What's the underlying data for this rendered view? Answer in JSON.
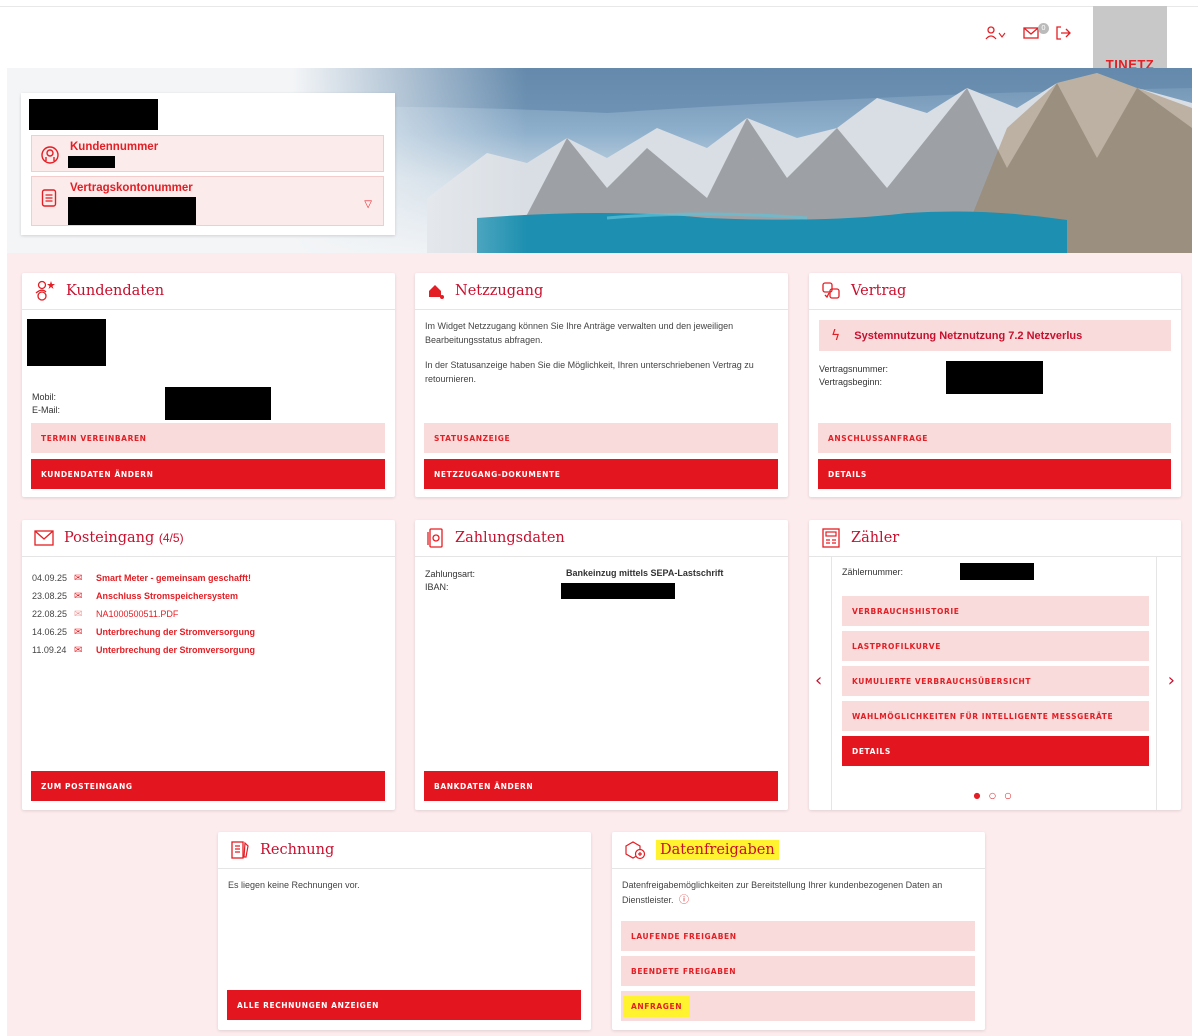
{
  "header": {
    "icons": [
      "user-menu-icon",
      "mail-icon",
      "logout-icon"
    ],
    "mail_count": "0",
    "logo": "TINETZ"
  },
  "account": {
    "customer_number_label": "Kundennummer",
    "contract_account_label": "Vertragskontonummer"
  },
  "kundendaten": {
    "title": "Kundendaten",
    "mobile_label": "Mobil:",
    "email_label": "E-Mail:",
    "btn_termin": "TERMIN VEREINBAREN",
    "btn_change": "KUNDENDATEN ÄNDERN"
  },
  "netzzugang": {
    "title": "Netzzugang",
    "text1": "Im Widget Netzzugang können Sie Ihre Anträge verwalten und den jeweiligen Bearbeitungsstatus abfragen.",
    "text2": "In der Statusanzeige haben Sie die Möglichkeit, Ihren unterschriebenen Vertrag zu retournieren.",
    "btn_status": "STATUSANZEIGE",
    "btn_docs": "NETZZUGANG-DOKUMENTE"
  },
  "vertrag": {
    "title": "Vertrag",
    "product": "Systemnutzung Netznutzung 7.2 Netzverlus",
    "contract_no_label": "Vertragsnummer:",
    "contract_start_label": "Vertragsbeginn:",
    "btn_request": "ANSCHLUSSANFRAGE",
    "btn_details": "DETAILS"
  },
  "posteingang": {
    "title": "Posteingang",
    "count": "(4/5)",
    "items": [
      {
        "date": "04.09.25",
        "subject": "Smart Meter - gemeinsam geschafft!"
      },
      {
        "date": "23.08.25",
        "subject": "Anschluss Stromspeichersystem"
      },
      {
        "date": "22.08.25",
        "subject": "NA1000500511.PDF"
      },
      {
        "date": "14.06.25",
        "subject": "Unterbrechung der Stromversorgung"
      },
      {
        "date": "11.09.24",
        "subject": "Unterbrechung der Stromversorgung"
      }
    ],
    "btn": "ZUM POSTEINGANG"
  },
  "zahlungsdaten": {
    "title": "Zahlungsdaten",
    "payment_label": "Zahlungsart:",
    "payment_value": "Bankeinzug mittels SEPA-Lastschrift",
    "iban_label": "IBAN:",
    "btn": "BANKDATEN ÄNDERN"
  },
  "zaehler": {
    "title": "Zähler",
    "meter_label": "Zählernummer:",
    "btn_history": "VERBRAUCHSHISTORIE",
    "btn_load": "LASTPROFILKURVE",
    "btn_cumulative": "KUMULIERTE VERBRAUCHSÜBERSICHT",
    "btn_options": "WAHLMÖGLICHKEITEN FÜR INTELLIGENTE MESSGERÄTE",
    "btn_details": "DETAILS",
    "prev": "‹",
    "next": "›",
    "dots": "● ○ ○"
  },
  "rechnung": {
    "title": "Rechnung",
    "text": "Es liegen keine Rechnungen vor.",
    "btn": "ALLE RECHNUNGEN ANZEIGEN"
  },
  "datenfreigaben": {
    "title": "Datenfreigaben",
    "text": "Datenfreigabemöglichkeiten zur Bereitstellung Ihrer kundenbezogenen Daten an Dienstleister.",
    "btn_running": "LAUFENDE FREIGABEN",
    "btn_ended": "BEENDETE FREIGABEN",
    "btn_request": "ANFRAGEN"
  },
  "colors": {
    "accent": "#e3151f",
    "accent_light": "#fadbdb",
    "highlight": "#fff22f"
  }
}
